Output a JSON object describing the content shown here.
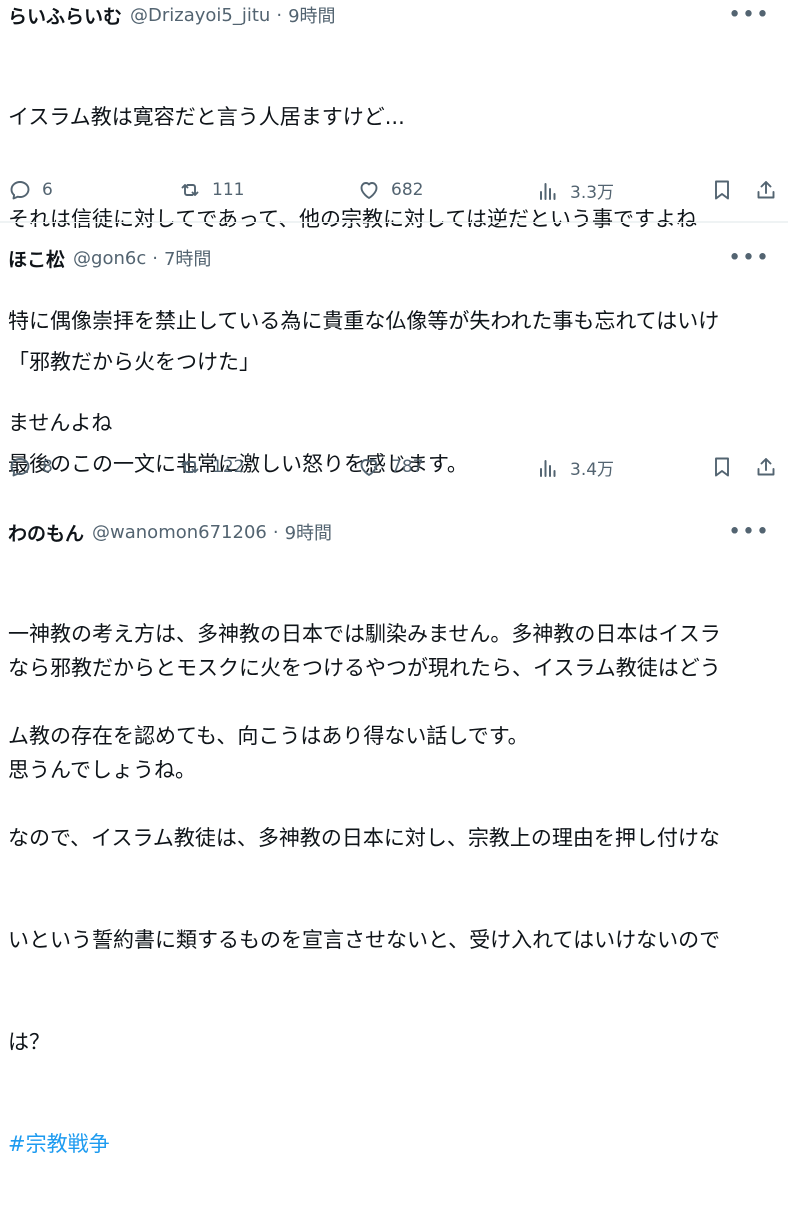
{
  "tweets": [
    {
      "name": "らいふらいむ",
      "handle": "@Drizayoi5_jitu",
      "time": "9時間",
      "lines": [
        "イスラム教は寛容だと言う人居ますけど...",
        "それは信徒に対してであって、他の宗教に対しては逆だという事ですよね",
        "特に偶像崇拝を禁止している為に貴重な仏像等が失われた事も忘れてはいけ",
        "ませんよね"
      ],
      "replies": "6",
      "retweets": "111",
      "likes": "682",
      "views": "3.3万"
    },
    {
      "name": "ほこ松",
      "handle": "@gon6c",
      "time": "7時間",
      "lines": [
        "「邪教だから火をつけた」",
        "最後のこの一文に非常に激しい怒りを感じます。",
        "",
        "なら邪教だからとモスクに火をつけるやつが現れたら、イスラム教徒はどう",
        "思うんでしょうね。"
      ],
      "replies": "8",
      "retweets": "122",
      "likes": "787",
      "views": "3.4万"
    },
    {
      "name": "わのもん",
      "handle": "@wanomon671206",
      "time": "9時間",
      "lines": [
        "一神教の考え方は、多神教の日本では馴染みません。多神教の日本はイスラ",
        "ム教の存在を認めても、向こうはあり得ない話しです。",
        "なので、イスラム教徒は、多神教の日本に対し、宗教上の理由を押し付けな",
        "いという誓約書に類するものを宣言させないと、受け入れてはいけないので",
        "は？"
      ],
      "hashtag": "#宗教戦争"
    }
  ]
}
